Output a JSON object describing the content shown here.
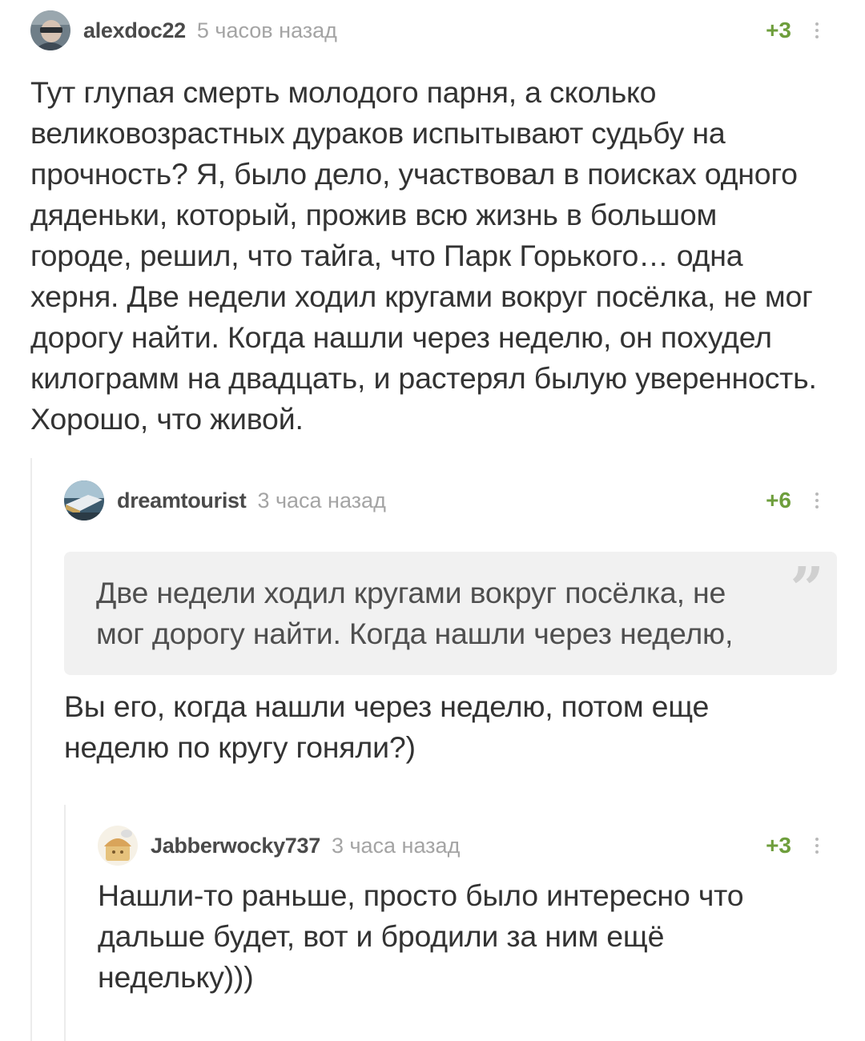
{
  "comments": [
    {
      "username": "alexdoc22",
      "time": "5 часов назад",
      "rating": "+3",
      "avatar": "user-avatar-photo",
      "text": "Тут глупая смерть молодого парня, а сколько великовозрастных дураков испытывают судьбу на прочность? Я, было дело, участвовал в поисках одного дяденьки, который, прожив всю жизнь в большом городе, решил, что тайга, что Парк Горького… одна херня. Две недели ходил кругами вокруг посёлка, не мог дорогу найти. Когда нашли через неделю, он похудел килограмм на двадцать, и растерял былую уверенность. Хорошо, что живой."
    },
    {
      "username": "dreamtourist",
      "time": "3 часа назад",
      "rating": "+6",
      "avatar": "user-avatar-photo",
      "quote": "Две недели ходил кругами вокруг посёлка, не мог дорогу найти. Когда нашли через неделю,",
      "quote_icon": "”",
      "text": "Вы его, когда нашли через неделю, потом еще неделю по кругу гоняли?)"
    },
    {
      "username": "Jabberwocky737",
      "time": "3 часа назад",
      "rating": "+3",
      "avatar": "user-avatar-drawing",
      "text": "Нашли-то раньше, просто было интересно что дальше будет, вот и бродили за ним ещё недельку)))"
    }
  ],
  "colors": {
    "rating": "#6e9e3c",
    "time": "#a4a4a4",
    "thread_line": "#ececec",
    "quote_bg": "#f1f1f1"
  }
}
